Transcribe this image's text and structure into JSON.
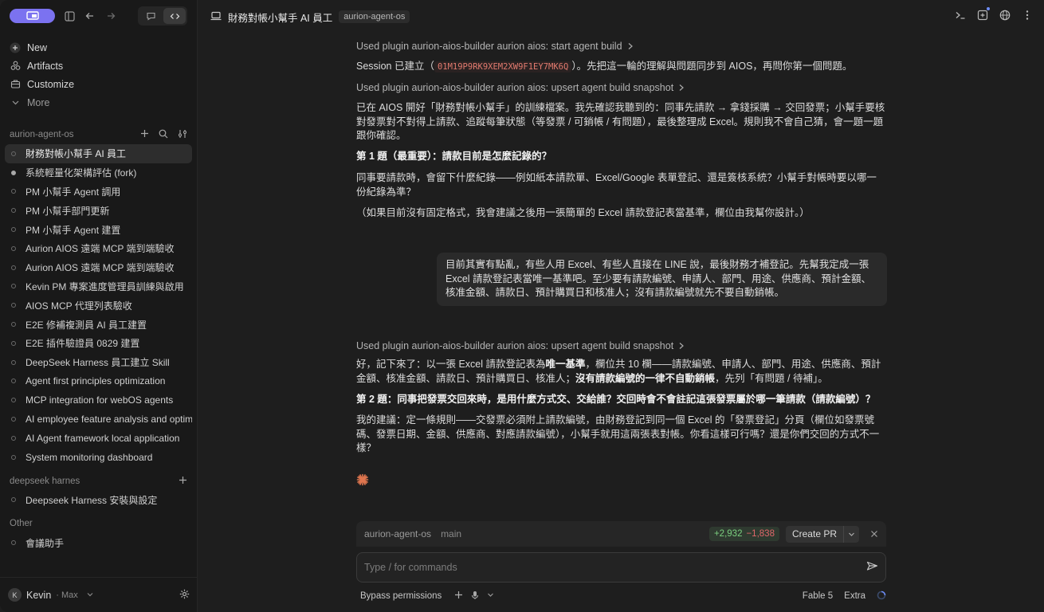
{
  "sidebar": {
    "menu": [
      {
        "label": "New",
        "icon": "plus-icon"
      },
      {
        "label": "Artifacts",
        "icon": "artifacts-icon"
      },
      {
        "label": "Customize",
        "icon": "customize-icon"
      },
      {
        "label": "More",
        "icon": "chevron-down-icon"
      }
    ],
    "project1": {
      "name": "aurion-agent-os",
      "items": [
        "財務對帳小幫手 AI 員工",
        "系統輕量化架構評估 (fork)",
        "PM 小幫手 Agent 調用",
        "PM 小幫手部門更新",
        "PM 小幫手 Agent 建置",
        "Aurion AIOS 遠端 MCP 端到端驗收",
        "Aurion AIOS 遠端 MCP 端到端驗收",
        "Kevin PM 專案進度管理員訓練與啟用",
        "AIOS MCP 代理列表驗收",
        "E2E 修補複測員 AI 員工建置",
        "E2E 插件驗證員 0829 建置",
        "DeepSeek Harness 員工建立 Skill",
        "Agent first principles optimization",
        "MCP integration for webOS agents",
        "AI employee feature analysis and optimization",
        "AI Agent framework local application",
        "System monitoring dashboard"
      ]
    },
    "project2": {
      "name": "deepseek harnes",
      "items": [
        "Deepseek Harness 安裝與設定"
      ]
    },
    "project3": {
      "name": "Other",
      "items": [
        "會議助手"
      ]
    },
    "user": {
      "initial": "K",
      "name": "Kevin",
      "plan": "· Max"
    }
  },
  "header": {
    "title": "財務對帳小幫手 AI 員工",
    "repo": "aurion-agent-os"
  },
  "chat": {
    "plugin1": "Used plugin aurion-aios-builder aurion aios: start agent build",
    "session_prefix": "Session 已建立（",
    "session_id": "01M19P9RK9XEM2XW9F1EY7MK6Q",
    "session_suffix": "）。先把這一輪的理解與問題同步到 AIOS，再問你第一個問題。",
    "plugin2": "Used plugin aurion-aios-builder aurion aios: upsert agent build snapshot",
    "p1": "已在 AIOS 開好「財務對帳小幫手」的訓練檔案。我先確認我聽到的：同事先請款 → 拿錢採購 → 交回發票；小幫手要核對發票對不對得上請款、追蹤每筆狀態（等發票 / 可銷帳 / 有問題），最後整理成 Excel。規則我不會自己猜，會一題一題跟你確認。",
    "q1": "第 1 題（最重要）：請款目前是怎麼記錄的？",
    "p2": "同事要請款時，會留下什麼紀錄——例如紙本請款單、Excel/Google 表單登記、還是簽核系統？小幫手對帳時要以哪一份紀錄為準？",
    "p3": "（如果目前沒有固定格式，我會建議之後用一張簡單的 Excel 請款登記表當基準，欄位由我幫你設計。）",
    "user_msg": "目前其實有點亂，有些人用 Excel、有些人直接在 LINE 說，最後財務才補登記。先幫我定成一張 Excel 請款登記表當唯一基準吧。至少要有請款編號、申請人、部門、用途、供應商、預計金額、核准金額、請款日、預計購買日和核准人；沒有請款編號就先不要自動銷帳。",
    "plugin3": "Used plugin aurion-aios-builder aurion aios: upsert agent build snapshot",
    "p4a": "好，記下來了：以一張 Excel 請款登記表為",
    "p4b": "唯一基準",
    "p4c": "，欄位共 10 欄——請款編號、申請人、部門、用途、供應商、預計金額、核准金額、請款日、預計購買日、核准人；",
    "p4d": "沒有請款編號的一律不自動銷帳",
    "p4e": "，先列「有問題 / 待補」。",
    "q2": "第 2 題：同事把發票交回來時，是用什麼方式交、交給誰？交回時會不會註記這張發票屬於哪一筆請款（請款編號）？",
    "p5": "我的建議：定一條規則——交發票必須附上請款編號，由財務登記到同一個 Excel 的「發票登記」分頁（欄位如發票號碼、發票日期、金額、供應商、對應請款編號），小幫手就用這兩張表對帳。你看這樣可行嗎？還是你們交回的方式不一樣？"
  },
  "composer": {
    "repo": "aurion-agent-os",
    "branch": "main",
    "additions": "+2,932",
    "deletions": "−1,838",
    "create_pr": "Create PR",
    "placeholder": "Type / for commands",
    "permissions": "Bypass permissions",
    "model": "Fable 5",
    "effort": "Extra"
  },
  "colors": {
    "accent": "#7b72f0",
    "spark": "#e0764f",
    "added": "#7bcf7f",
    "deleted": "#e0676a"
  }
}
